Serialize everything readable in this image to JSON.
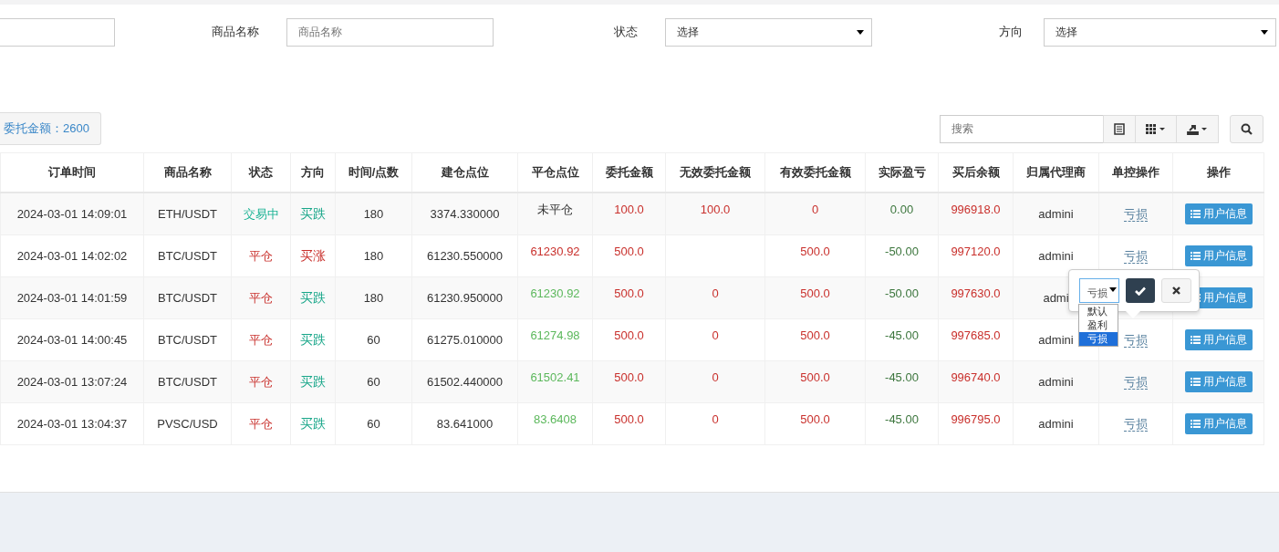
{
  "filters": [
    {
      "kind": "input"
    },
    {
      "label": "商品名称",
      "placeholder": "商品名称",
      "kind": "input"
    },
    {
      "label": "状态",
      "value": "选择",
      "kind": "select"
    },
    {
      "label": "方向",
      "value": "选择",
      "kind": "select"
    }
  ],
  "summary": {
    "label": "委托金额：",
    "value": "2600"
  },
  "toolbar": {
    "search_placeholder": "搜索"
  },
  "table": {
    "columns": [
      "订单时间",
      "商品名称",
      "状态",
      "方向",
      "时间/点数",
      "建仓点位",
      "平仓点位",
      "委托金额",
      "无效委托金额",
      "有效委托金额",
      "实际盈亏",
      "买后余额",
      "归属代理商",
      "单控操作",
      "操作"
    ],
    "rows": [
      {
        "time": "2024-03-01 14:09:01",
        "product": "ETH/USDT",
        "status": {
          "text": "交易中",
          "color": "#1ab394"
        },
        "direction": {
          "text": "买跌",
          "color": "#18a689"
        },
        "duration": "180",
        "open_price": "3374.330000",
        "close_price": {
          "text": "未平仓",
          "color": "#333333"
        },
        "amount": "100.0",
        "invalid_amount": "100.0",
        "valid_amount": "0",
        "profit": "0.00",
        "balance": "996918.0",
        "agent": "admini",
        "control": "亏损",
        "action": "用户信息"
      },
      {
        "time": "2024-03-01 14:02:02",
        "product": "BTC/USDT",
        "status": {
          "text": "平仓",
          "color": "#c9302c"
        },
        "direction": {
          "text": "买涨",
          "color": "#c9302c"
        },
        "duration": "180",
        "open_price": "61230.550000",
        "close_price": {
          "text": "61230.92",
          "color": "#c9302c"
        },
        "amount": "500.0",
        "invalid_amount": "",
        "valid_amount": "500.0",
        "profit": "-50.00",
        "balance": "997120.0",
        "agent": "admini",
        "control": "亏损",
        "action": "用户信息"
      },
      {
        "time": "2024-03-01 14:01:59",
        "product": "BTC/USDT",
        "status": {
          "text": "平仓",
          "color": "#c9302c"
        },
        "direction": {
          "text": "买跌",
          "color": "#18a689"
        },
        "duration": "180",
        "open_price": "61230.950000",
        "close_price": {
          "text": "61230.92",
          "color": "#5cb85c"
        },
        "amount": "500.0",
        "invalid_amount": "0",
        "valid_amount": "500.0",
        "profit": "-50.00",
        "balance": "997630.0",
        "agent": "admi",
        "action": "用户信息"
      },
      {
        "time": "2024-03-01 14:00:45",
        "product": "BTC/USDT",
        "status": {
          "text": "平仓",
          "color": "#c9302c"
        },
        "direction": {
          "text": "买跌",
          "color": "#18a689"
        },
        "duration": "60",
        "open_price": "61275.010000",
        "close_price": {
          "text": "61274.98",
          "color": "#5cb85c"
        },
        "amount": "500.0",
        "invalid_amount": "0",
        "valid_amount": "500.0",
        "profit": "-45.00",
        "balance": "997685.0",
        "agent": "admini",
        "control": "亏损",
        "action": "用户信息"
      },
      {
        "time": "2024-03-01 13:07:24",
        "product": "BTC/USDT",
        "status": {
          "text": "平仓",
          "color": "#c9302c"
        },
        "direction": {
          "text": "买跌",
          "color": "#18a689"
        },
        "duration": "60",
        "open_price": "61502.440000",
        "close_price": {
          "text": "61502.41",
          "color": "#5cb85c"
        },
        "amount": "500.0",
        "invalid_amount": "0",
        "valid_amount": "500.0",
        "profit": "-45.00",
        "balance": "996740.0",
        "agent": "admini",
        "control": "亏损",
        "action": "用户信息"
      },
      {
        "time": "2024-03-01 13:04:37",
        "product": "PVSC/USD",
        "status": {
          "text": "平仓",
          "color": "#c9302c"
        },
        "direction": {
          "text": "买跌",
          "color": "#18a689"
        },
        "duration": "60",
        "open_price": "83.641000",
        "close_price": {
          "text": "83.6408",
          "color": "#5cb85c"
        },
        "amount": "500.0",
        "invalid_amount": "0",
        "valid_amount": "500.0",
        "profit": "-45.00",
        "balance": "996795.0",
        "agent": "admini",
        "control": "亏损",
        "action": "用户信息"
      }
    ]
  },
  "popup": {
    "select_value": "亏损",
    "options": [
      {
        "label": "默认",
        "selected": false
      },
      {
        "label": "盈利",
        "selected": false
      },
      {
        "label": "亏损",
        "selected": true
      }
    ]
  }
}
